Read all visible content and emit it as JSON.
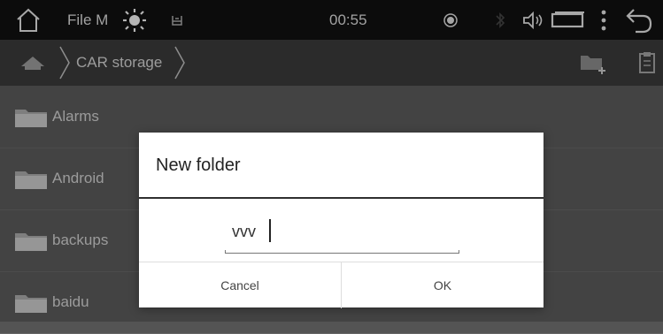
{
  "status_bar": {
    "app_label": "File M",
    "time": "00:55"
  },
  "path_bar": {
    "breadcrumb": "CAR storage"
  },
  "folders": [
    {
      "name": "Alarms"
    },
    {
      "name": "Android"
    },
    {
      "name": "backups"
    },
    {
      "name": "baidu"
    }
  ],
  "dialog": {
    "title": "New folder",
    "input_value": "vvv",
    "cancel_label": "Cancel",
    "ok_label": "OK"
  },
  "colors": {
    "status_bar_bg": "#101010",
    "path_bar_bg": "#3a3a3a",
    "list_bg": "#5a5a5a",
    "dialog_bg": "#ffffff"
  }
}
